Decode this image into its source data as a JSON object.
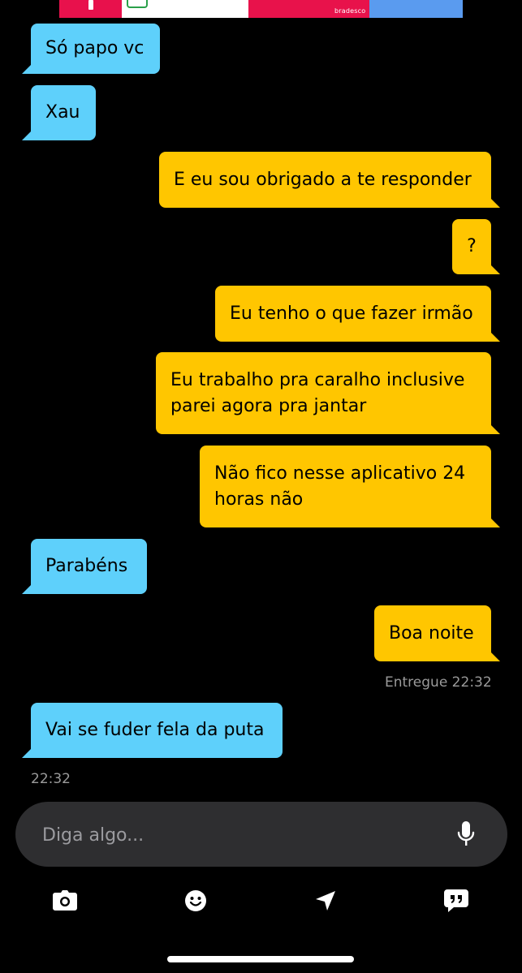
{
  "ad": {
    "brand": "bradesco"
  },
  "messages": [
    {
      "dir": "in",
      "text": "Só papo vc"
    },
    {
      "dir": "in",
      "text": "Xau"
    },
    {
      "dir": "out",
      "text": "E eu sou obrigado a te responder"
    },
    {
      "dir": "out",
      "text": "?"
    },
    {
      "dir": "out",
      "text": "Eu tenho o que fazer irmão"
    },
    {
      "dir": "out",
      "lines": [
        "Eu trabalho pra caralho inclusive",
        "parei agora pra jantar"
      ]
    },
    {
      "dir": "out",
      "lines": [
        "Não fico nesse aplicativo 24",
        "horas não"
      ]
    },
    {
      "dir": "in",
      "text": "Parabéns"
    },
    {
      "dir": "out",
      "text": "Boa noite"
    },
    {
      "dir": "in",
      "text": "Vai se fuder fela da puta"
    }
  ],
  "status": {
    "delivered": "Entregue 22:32",
    "received_time": "22:32"
  },
  "composer": {
    "placeholder": "Diga algo..."
  },
  "toolbar": {
    "icons": [
      "camera-icon",
      "emoji-icon",
      "location-icon",
      "saved-phrases-icon"
    ]
  },
  "colors": {
    "incoming": "#5ed0fb",
    "outgoing": "#ffc600",
    "background": "#000000"
  }
}
